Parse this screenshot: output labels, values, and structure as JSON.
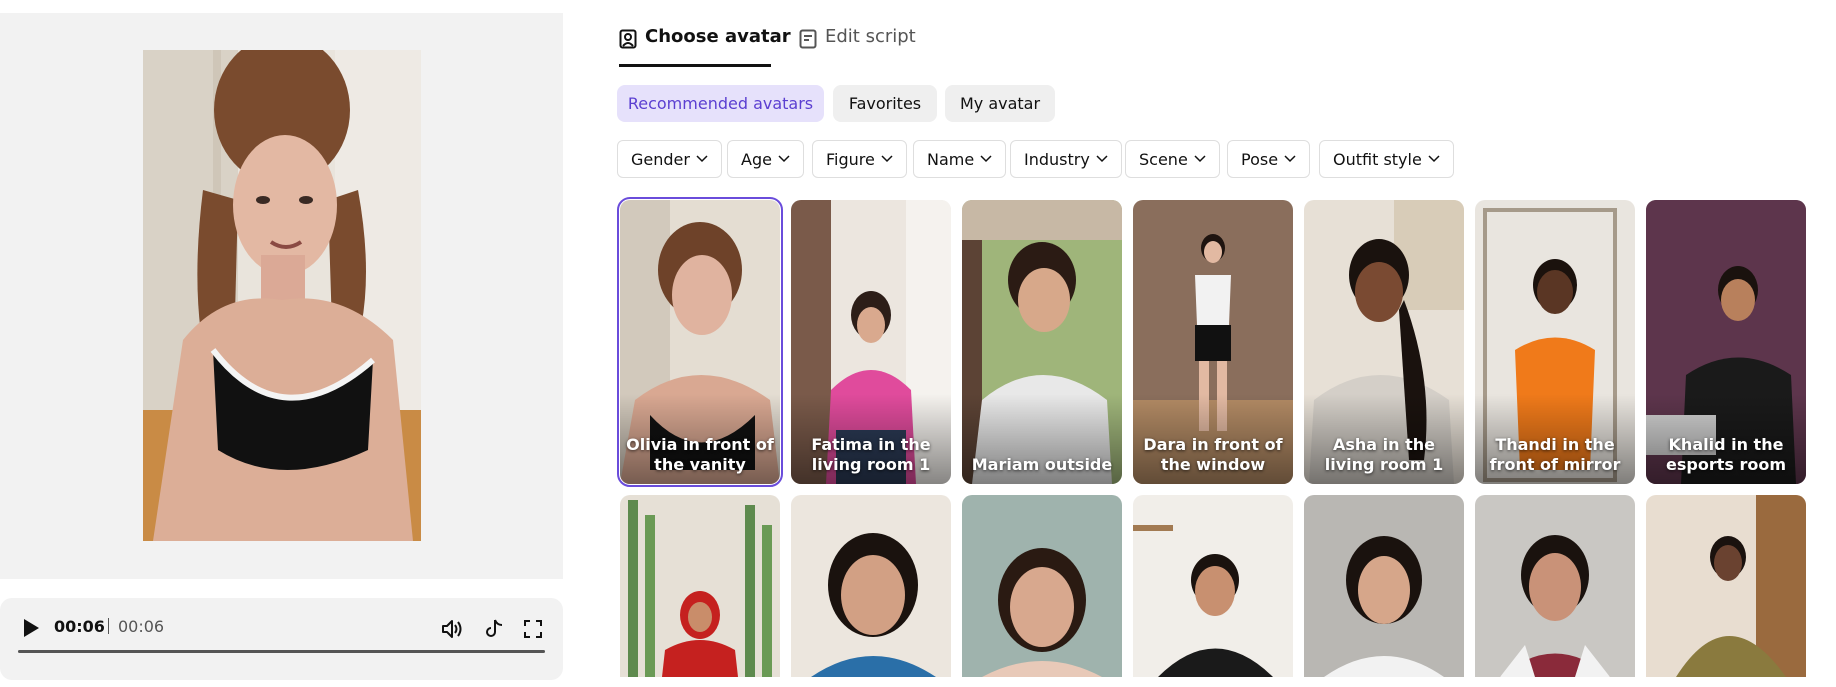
{
  "player": {
    "current_time": "00:06",
    "total_time": "00:06",
    "progress": 1.0,
    "icons": [
      "play-icon",
      "volume-icon",
      "tiktok-icon",
      "fullscreen-icon"
    ]
  },
  "tabs": [
    {
      "label": "Choose avatar",
      "icon": "avatar-icon",
      "active": true
    },
    {
      "label": "Edit script",
      "icon": "script-icon",
      "active": false
    }
  ],
  "pills": [
    {
      "label": "Recommended avatars",
      "active": true
    },
    {
      "label": "Favorites",
      "active": false
    },
    {
      "label": "My avatar",
      "active": false
    }
  ],
  "filters": [
    "Gender",
    "Age",
    "Figure",
    "Name",
    "Industry",
    "Scene",
    "Pose",
    "Outfit style"
  ],
  "avatars_row1": [
    {
      "label": "Olivia in front of the vanity",
      "selected": true
    },
    {
      "label": "Fatima in the living room 1",
      "selected": false
    },
    {
      "label": "Mariam outside",
      "selected": false
    },
    {
      "label": "Dara in front of the window",
      "selected": false
    },
    {
      "label": "Asha in the living room 1",
      "selected": false
    },
    {
      "label": "Thandi in the front of mirror",
      "selected": false
    },
    {
      "label": "Khalid in the esports room",
      "selected": false
    }
  ],
  "colors": {
    "accent": "#6a4cdb",
    "pill_active_bg": "#e6e1fb",
    "panel_bg": "#f2f2f2"
  }
}
